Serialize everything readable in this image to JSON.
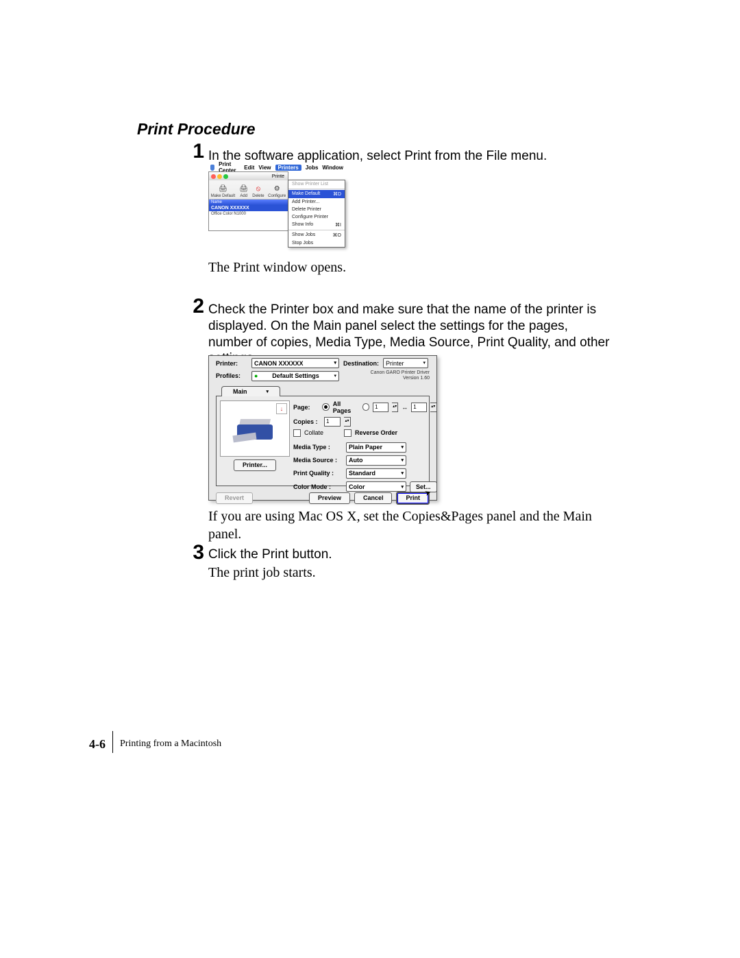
{
  "section_title": "Print Procedure",
  "steps": {
    "s1": {
      "num": "1",
      "instruction": "In the software application, select Print from the File menu.",
      "result": "The Print window opens."
    },
    "s2": {
      "num": "2",
      "instruction": "Check the Printer box and make sure that the name of the printer is displayed. On the Main panel select the settings for the pages, number of copies, Media Type, Media Source, Print Quality, and other settings.",
      "result": "If you are using Mac OS X, set the Copies&Pages panel and the Main panel."
    },
    "s3": {
      "num": "3",
      "instruction": "Click the Print button.",
      "result": "The print job starts."
    }
  },
  "shot1": {
    "menubar": {
      "items": [
        "Print Center",
        "Edit",
        "View",
        "Printers",
        "Jobs",
        "Window"
      ],
      "active": "Printers"
    },
    "window_title": "Printe",
    "toolbar": {
      "make_default": "Make Default",
      "add": "Add",
      "delete": "Delete",
      "configure": "Configure"
    },
    "list_header": "Name",
    "list_selected": "CANON XXXXXX",
    "list_other": "Office Color N1000",
    "dropdown": {
      "show_list": {
        "label": "Show Printer List"
      },
      "make_default": {
        "label": "Make Default",
        "shortcut": "⌘D"
      },
      "add_printer": {
        "label": "Add Printer..."
      },
      "delete_printer": {
        "label": "Delete Printer"
      },
      "configure_printer": {
        "label": "Configure Printer"
      },
      "show_info": {
        "label": "Show Info",
        "shortcut": "⌘I"
      },
      "show_jobs": {
        "label": "Show Jobs",
        "shortcut": "⌘O"
      },
      "stop_jobs": {
        "label": "Stop Jobs"
      }
    }
  },
  "shot2": {
    "labels": {
      "printer": "Printer:",
      "destination": "Destination:",
      "profiles": "Profiles:",
      "page": "Page:",
      "copies": "Copies :",
      "collate": "Collate",
      "reverse": "Reverse Order",
      "media_type": "Media Type :",
      "media_source": "Media Source :",
      "print_quality": "Print Quality :",
      "color_mode": "Color Mode :",
      "all_pages": "All Pages",
      "range_sep": "↔"
    },
    "values": {
      "printer_name": "CANON XXXXXX",
      "destination": "Printer",
      "profiles": "Default Settings",
      "tab": "Main",
      "copies": "1",
      "range_from": "1",
      "range_to": "1",
      "media_type": "Plain Paper",
      "media_source": "Auto",
      "print_quality": "Standard",
      "color_mode": "Color"
    },
    "version": {
      "line1": "Canon GARO Printer Driver",
      "line2": "Version 1.60"
    },
    "buttons": {
      "printer": "Printer...",
      "set": "Set...",
      "revert": "Revert",
      "preview": "Preview",
      "cancel": "Cancel",
      "print": "Print"
    }
  },
  "footer": {
    "page_number": "4-6",
    "chapter": "Printing from a Macintosh"
  }
}
